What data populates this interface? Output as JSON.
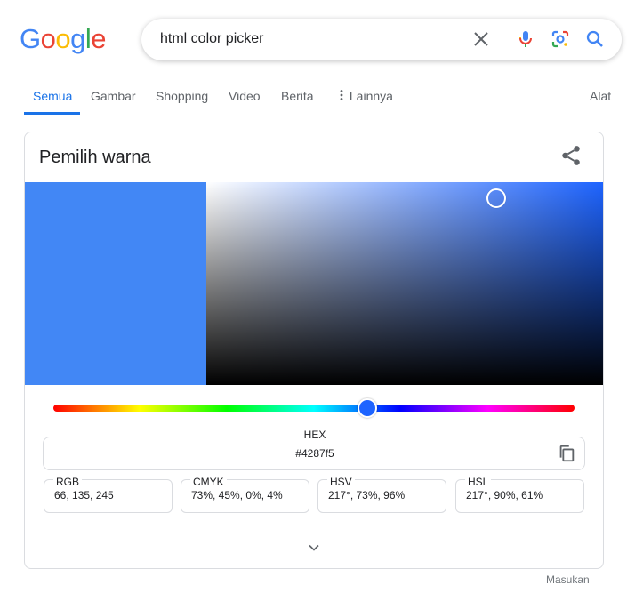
{
  "logo": {
    "letters": [
      "G",
      "o",
      "o",
      "g",
      "l",
      "e"
    ],
    "colors": [
      "#4285f4",
      "#ea4335",
      "#fbbc05",
      "#4285f4",
      "#34a853",
      "#ea4335"
    ]
  },
  "search": {
    "query": "html color picker"
  },
  "tabs": [
    {
      "label": "Semua",
      "active": true
    },
    {
      "label": "Gambar"
    },
    {
      "label": "Shopping"
    },
    {
      "label": "Video"
    },
    {
      "label": "Berita"
    },
    {
      "label": "Lainnya"
    }
  ],
  "tools_label": "Alat",
  "picker": {
    "title": "Pemilih warna",
    "color": "#4287f5",
    "hue_color": "#1e64ff",
    "hue_fraction": 0.603,
    "saturation": 0.73,
    "value": 0.96,
    "hex_label": "HEX",
    "hex_value": "#4287f5",
    "formats": [
      {
        "label": "RGB",
        "value": "66, 135, 245"
      },
      {
        "label": "CMYK",
        "value": "73%, 45%, 0%, 4%"
      },
      {
        "label": "HSV",
        "value": "217°, 73%, 96%"
      },
      {
        "label": "HSL",
        "value": "217°, 90%, 61%"
      }
    ]
  },
  "feedback_label": "Masukan"
}
